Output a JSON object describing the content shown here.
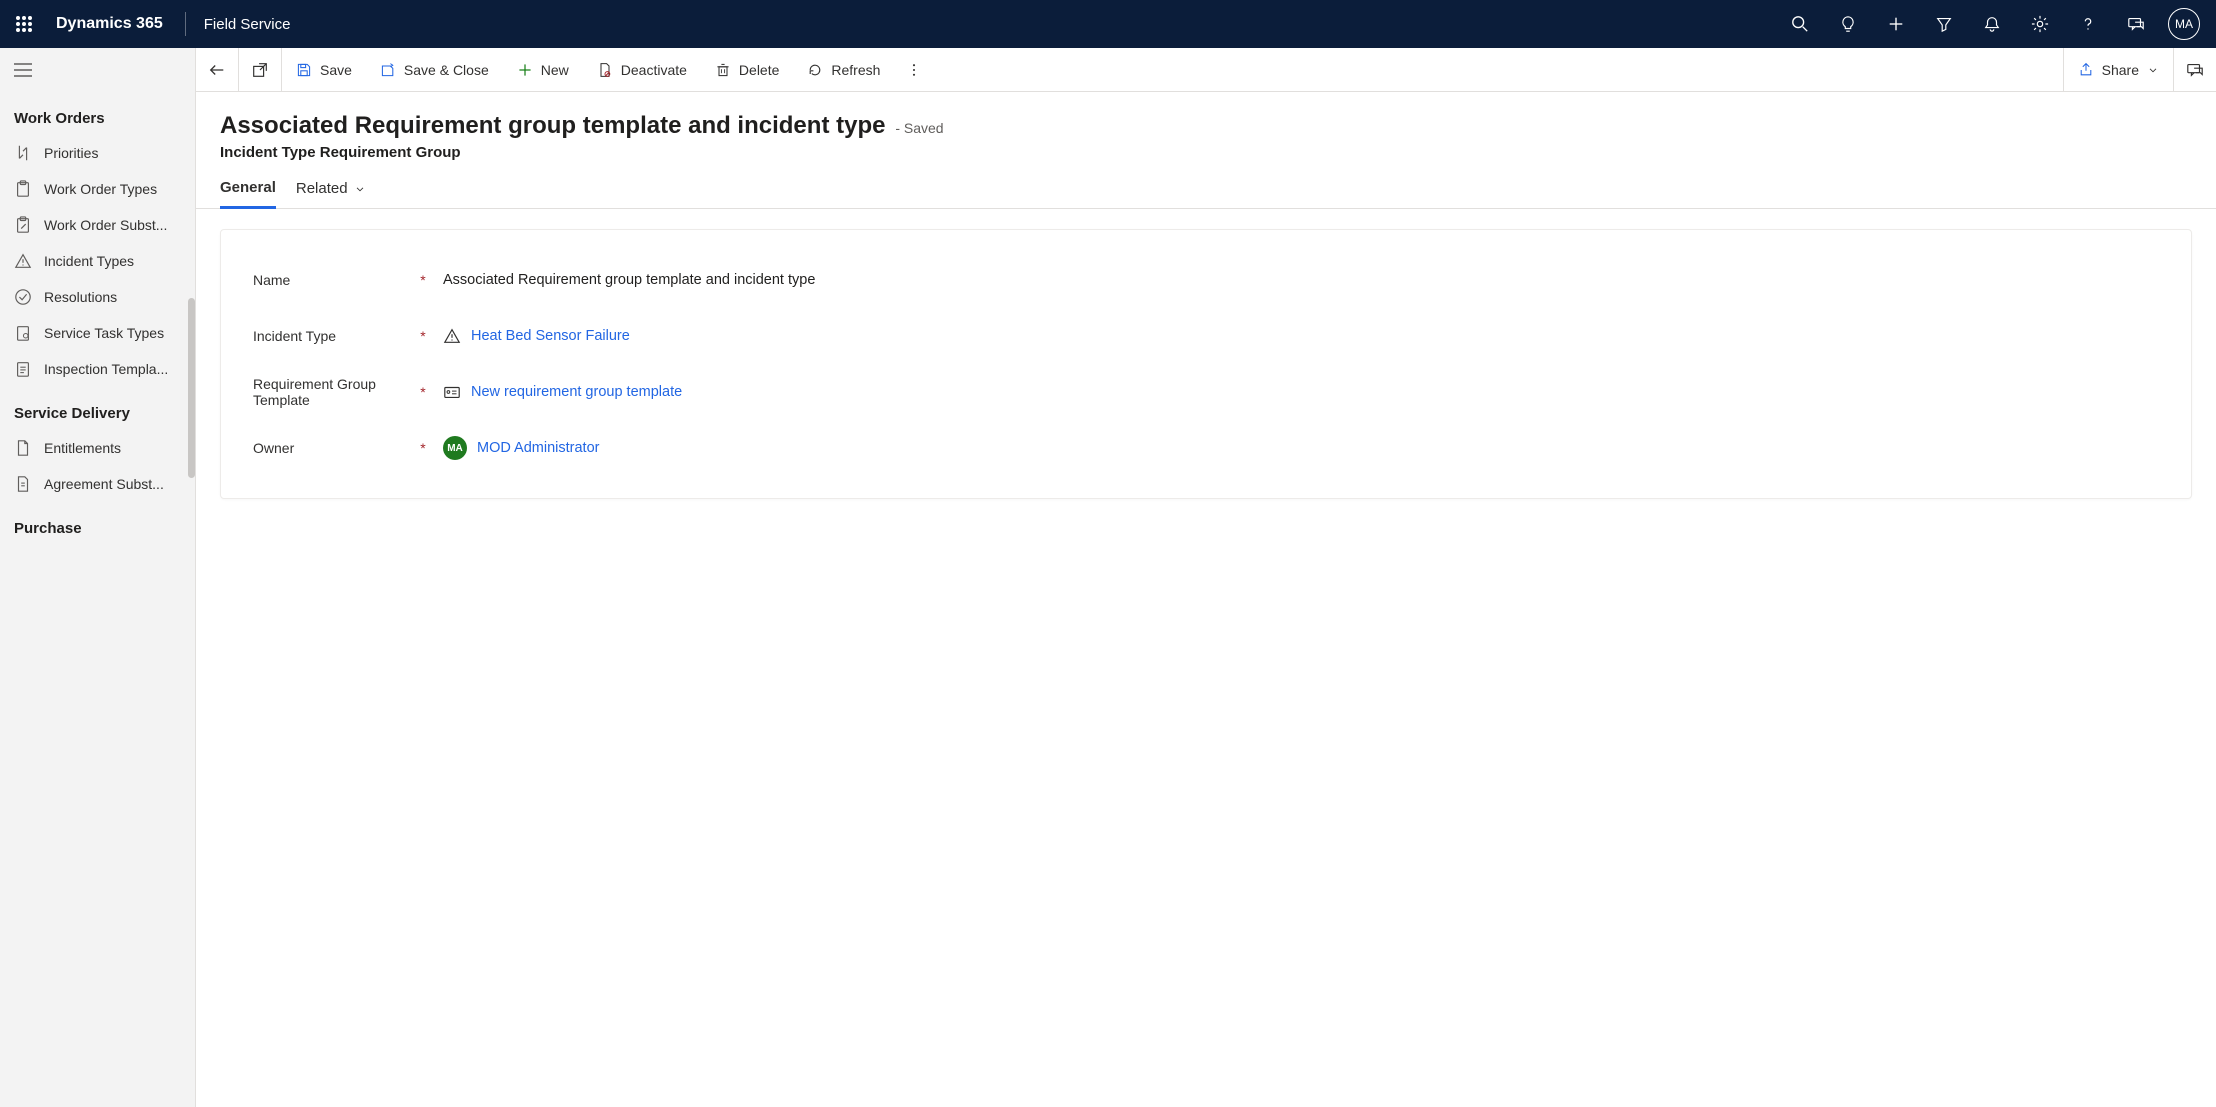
{
  "topbar": {
    "brand": "Dynamics 365",
    "app": "Field Service",
    "avatar_initials": "MA"
  },
  "sidebar": {
    "sections": [
      {
        "title": "Work Orders",
        "items": [
          {
            "label": "Priorities"
          },
          {
            "label": "Work Order Types"
          },
          {
            "label": "Work Order Subst..."
          },
          {
            "label": "Incident Types"
          },
          {
            "label": "Resolutions"
          },
          {
            "label": "Service Task Types"
          },
          {
            "label": "Inspection Templa..."
          }
        ]
      },
      {
        "title": "Service Delivery",
        "items": [
          {
            "label": "Entitlements"
          },
          {
            "label": "Agreement Subst..."
          }
        ]
      },
      {
        "title": "Purchase",
        "items": []
      }
    ]
  },
  "commands": {
    "save": "Save",
    "save_close": "Save & Close",
    "new": "New",
    "deactivate": "Deactivate",
    "delete": "Delete",
    "refresh": "Refresh",
    "share": "Share"
  },
  "record": {
    "title": "Associated Requirement group template and incident type",
    "status": "- Saved",
    "entity": "Incident Type Requirement Group",
    "tabs": {
      "general": "General",
      "related": "Related"
    },
    "fields": {
      "name": {
        "label": "Name",
        "required": "*",
        "value": "Associated Requirement group template and incident type"
      },
      "incident_type": {
        "label": "Incident Type",
        "required": "*",
        "value": "Heat Bed Sensor Failure"
      },
      "req_group_template": {
        "label": "Requirement Group Template",
        "required": "*",
        "value": "New requirement group template"
      },
      "owner": {
        "label": "Owner",
        "required": "*",
        "value": "MOD Administrator",
        "initials": "MA"
      }
    }
  }
}
